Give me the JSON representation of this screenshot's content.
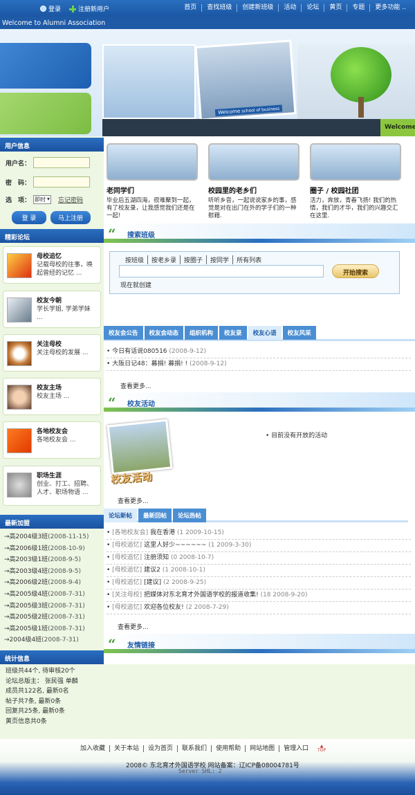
{
  "topbar": {
    "login": "登录",
    "register": "注册新用户",
    "nav": [
      "首页",
      "查找班级",
      "创建新班级",
      "活动",
      "论坛",
      "黄页",
      "专题",
      "更多功能 .."
    ]
  },
  "welcome_bar": "Welcome to Alumni Association",
  "banner": {
    "photo_caption": "Welcome",
    "photo_caption2": "school of business",
    "welcome_tag": "Welcome"
  },
  "user_info": {
    "title": "用户信息",
    "username_label": "用户名：",
    "password_label": "密　码：",
    "option_label": "选　项：",
    "option_value": "即时",
    "forgot": "忘记密码",
    "login_btn": "登 录",
    "register_btn": "马上注册"
  },
  "forum": {
    "title": "精彩论坛",
    "items": [
      {
        "title": "母校追忆",
        "desc": "记载母校的往事，唤起曾经的记忆 ..."
      },
      {
        "title": "校友今朝",
        "desc": "学长学姐, 学弟学妹 ..."
      },
      {
        "title": "关注母校",
        "desc": "关注母校的发展 ..."
      },
      {
        "title": "校友主场",
        "desc": "校友主场 ..."
      },
      {
        "title": "各地校友会",
        "desc": "各地校友会 ..."
      },
      {
        "title": "职场生涯",
        "desc": "创业、打工、招聘、人才、职场物语 ..."
      }
    ]
  },
  "latest_join": {
    "title": "最新加盟",
    "items": [
      {
        "name": "→高2004级3班",
        "date": "(2008-11-15)"
      },
      {
        "name": "→高2006级1班",
        "date": "(2008-10-9)"
      },
      {
        "name": "→高2003级1班",
        "date": "(2008-9-5)"
      },
      {
        "name": "→高2003级4班",
        "date": "(2008-9-5)"
      },
      {
        "name": "→高2006级2班",
        "date": "(2008-9-4)"
      },
      {
        "name": "→高2005级4班",
        "date": "(2008-7-31)"
      },
      {
        "name": "→高2005级3班",
        "date": "(2008-7-31)"
      },
      {
        "name": "→高2005级2班",
        "date": "(2008-7-31)"
      },
      {
        "name": "→高2005级1班",
        "date": "(2008-7-31)"
      },
      {
        "name": "→2004级4班",
        "date": "(2008-7-31)"
      }
    ]
  },
  "stats": {
    "title": "统计信息",
    "items": [
      "班级共44个, 待审核20个",
      "论坛总版主： 张民强 单麟",
      "成员共122名, 最新0名",
      "帖子共7条, 最新0条",
      "回复共25条, 最新0条",
      "黄页信息共0条"
    ]
  },
  "features": [
    {
      "title": "老同学们",
      "desc": "毕业后五湖四海，很难聚到一起，有了校友录，让我感觉我们还是在一起!"
    },
    {
      "title": "校园里的老乡们",
      "desc": "听听乡音，一起说说家乡的事，感觉是对在出门在外的学子们的一种慰藉."
    },
    {
      "title": "圈子 / 校园社团",
      "desc": "活力，奔放，青春飞扬! 我们的热情，我们的才华，我们的兴趣交汇在这里."
    }
  ],
  "search_class": {
    "title": "搜索班级",
    "tabs": [
      "按班级",
      "按老乡录",
      "按圈子",
      "按同学",
      "所有列表"
    ],
    "button": "开始搜索",
    "create_now": "现在就创建"
  },
  "news_tabs": [
    "校友会公告",
    "校友会动态",
    "组织机构",
    "校友录",
    "校友心语",
    "校友风采"
  ],
  "news_active": 4,
  "news": [
    {
      "title": "今日有话说080516",
      "date": "(2008-9-12)"
    },
    {
      "title": "大阪日记48：募捐! 募捐! !",
      "date": "(2008-9-12)"
    }
  ],
  "more": "查看更多...",
  "activity": {
    "title": "校友活动",
    "photo_text": "校友活动",
    "empty": "目前没有开放的活动"
  },
  "forum_tabs": [
    "论坛新帖",
    "最新回帖",
    "论坛热帖"
  ],
  "forum_posts": [
    {
      "board": "[各地校友会]",
      "title": "我在香港",
      "meta": "(1 2009-10-15)"
    },
    {
      "board": "[母校追忆]",
      "title": "这里人好少~~~~~~",
      "meta": "(1 2009-3-30)"
    },
    {
      "board": "[母校追忆]",
      "title": "注册须知",
      "meta": "(0 2008-10-7)"
    },
    {
      "board": "[母校追忆]",
      "title": "建议2",
      "meta": "(1 2008-10-1)"
    },
    {
      "board": "[母校追忆]",
      "title": "[建议]",
      "meta": "(2 2008-9-25)"
    },
    {
      "board": "[关注母校]",
      "title": "把媒体对东北育才外国语学校的报道收集!",
      "meta": "(18 2008-9-20)"
    },
    {
      "board": "[母校追忆]",
      "title": "欢迎各位校友!",
      "meta": "(2 2008-7-29)"
    }
  ],
  "links": {
    "title": "友情链接"
  },
  "footer": {
    "links": [
      "加入收藏",
      "关于本站",
      "设为首页",
      "联系我们",
      "使用帮助",
      "网站地图",
      "管理入口"
    ],
    "top": "TOP",
    "copyright": "2008© 东北育才外国语学校 网站备案：辽ICP备08004781号",
    "server": "Server SHL: 2"
  },
  "colors": {
    "blue": "#1e5aa6",
    "green": "#7cbd43",
    "sidebar_bg": "#eef6e4"
  }
}
